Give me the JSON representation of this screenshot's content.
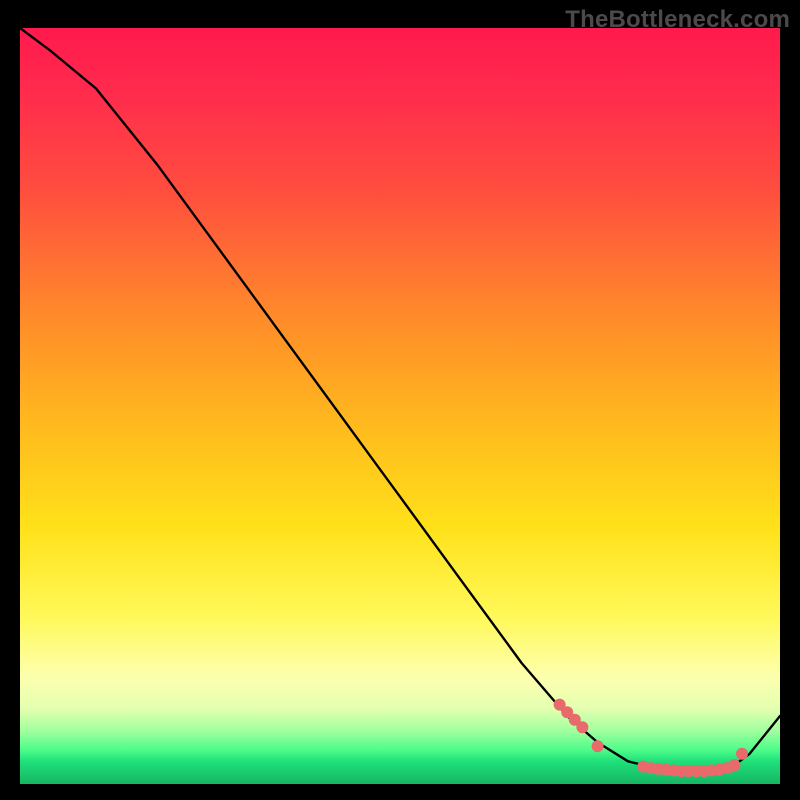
{
  "watermark": "TheBottleneck.com",
  "colors": {
    "dot": "#e86a6a",
    "curve": "#000000"
  },
  "chart_data": {
    "type": "line",
    "title": "",
    "xlabel": "",
    "ylabel": "",
    "xlim": [
      0,
      100
    ],
    "ylim": [
      0,
      100
    ],
    "grid": false,
    "legend": false,
    "x": [
      0,
      4,
      10,
      18,
      26,
      34,
      42,
      50,
      58,
      66,
      72,
      76,
      80,
      84,
      86,
      88,
      90,
      92,
      94,
      96,
      100
    ],
    "values": [
      100,
      97,
      92,
      82,
      71,
      60,
      49,
      38,
      27,
      16,
      9,
      5.5,
      3,
      2,
      1.8,
      1.7,
      1.7,
      1.9,
      2.5,
      4,
      9
    ],
    "markers_x": [
      71,
      72,
      73,
      74,
      76,
      82,
      83,
      84,
      85,
      86,
      87,
      88,
      89,
      90,
      91,
      92,
      93,
      94,
      95
    ],
    "markers_y": [
      10.5,
      9.5,
      8.5,
      7.5,
      5,
      2.3,
      2.1,
      2.0,
      1.9,
      1.8,
      1.7,
      1.7,
      1.7,
      1.7,
      1.8,
      1.9,
      2.1,
      2.5,
      4.0
    ]
  }
}
